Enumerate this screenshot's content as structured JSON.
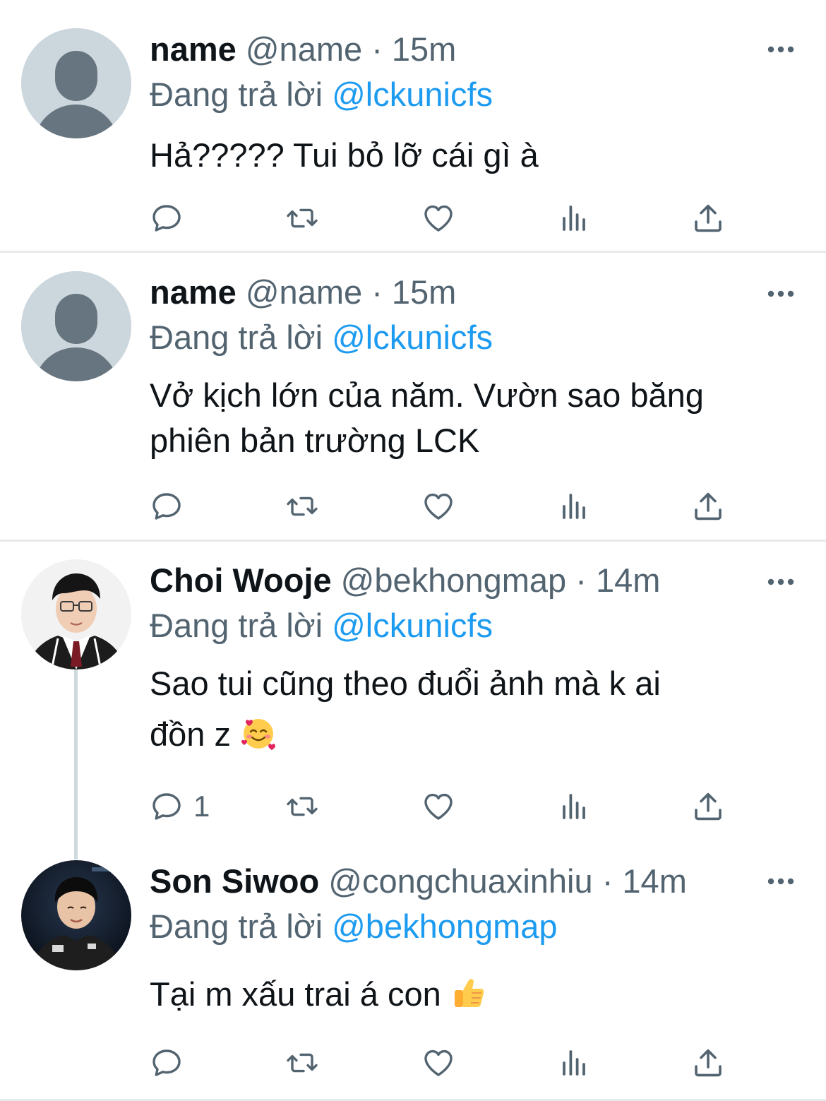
{
  "tweets": [
    {
      "display_name": "name",
      "handle": "@name",
      "separator": "·",
      "time": "15m",
      "reply_prefix": "Đang trả lời",
      "reply_to": "@lckunicfs",
      "text": "Hả????? Tui bỏ lỡ cái gì à",
      "avatar_icon": "default-profile-icon",
      "reply_count": ""
    },
    {
      "display_name": "name",
      "handle": "@name",
      "separator": "·",
      "time": "15m",
      "reply_prefix": "Đang trả lời",
      "reply_to": "@lckunicfs",
      "text_lines": [
        "Vở kịch lớn của năm. Vườn sao băng",
        "phiên bản trường LCK"
      ],
      "avatar_icon": "default-profile-icon",
      "reply_count": ""
    },
    {
      "display_name": "Choi Wooje",
      "handle": "@bekhongmap",
      "separator": "·",
      "time": "14m",
      "reply_prefix": "Đang trả lời",
      "reply_to": "@lckunicfs",
      "text_lines": [
        "Sao tui cũng theo đuổi ảnh mà k ai",
        "đồn z"
      ],
      "text_emoji": "smiling-face-with-hearts-emoji",
      "avatar_icon": "profile-photo",
      "reply_count": "1"
    },
    {
      "display_name": "Son Siwoo",
      "handle": "@congchuaxinhiu",
      "separator": "·",
      "time": "14m",
      "reply_prefix": "Đang trả lời",
      "reply_to": "@bekhongmap",
      "text": "Tại m xấu trai á con",
      "text_emoji": "thumbs-up-emoji",
      "avatar_icon": "profile-photo",
      "reply_count": ""
    }
  ],
  "colors": {
    "mention": "#1d9bf0",
    "secondary": "#536471",
    "primary_text": "#0f1419",
    "divider": "#e7e9eb"
  },
  "action_icons": [
    "reply-icon",
    "retweet-icon",
    "like-icon",
    "analytics-icon",
    "share-icon"
  ]
}
